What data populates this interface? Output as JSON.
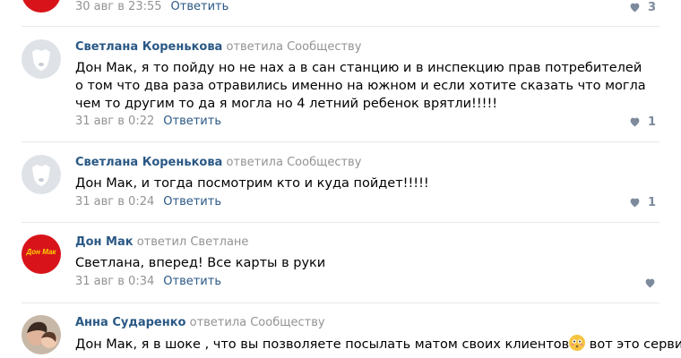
{
  "feed": {
    "prev_comment": {
      "time": "30 авг в 23:55",
      "reply_label": "Ответить",
      "likes": "3"
    },
    "comments": [
      {
        "author": "Светлана Коренькова",
        "replied_to": "ответила Сообществу",
        "text": "Дон Мак, я то пойду но не нах а в сан станцию и в инспекцию прав потребителей о том что два раза отравились именно на южном и если хотите сказать что могла чем то другим то да я могла но 4 летний ребенок врятли!!!!!",
        "time": "31 авг в 0:22",
        "reply_label": "Ответить",
        "likes": "1"
      },
      {
        "author": "Светлана Коренькова",
        "replied_to": "ответила Сообществу",
        "text": "Дон Мак, и тогда посмотрим кто и куда пойдет!!!!!",
        "time": "31 авг в 0:24",
        "reply_label": "Ответить",
        "likes": "1"
      },
      {
        "author": "Дон Мак",
        "replied_to": "ответил Светлане",
        "text": "Светлана, вперед! Все карты в руки",
        "time": "31 авг в 0:34",
        "reply_label": "Ответить",
        "likes": "",
        "avatar_logo": "Дон Мак"
      },
      {
        "author": "Анна Сударенко",
        "replied_to": "ответила Сообществу",
        "text": "Дон Мак, я в шоке , что вы позволяете посылать матом своих клиентов",
        "text_after_emoji": " вот это сервис"
      }
    ]
  },
  "colors": {
    "link": "#2a5885",
    "meta": "#939393",
    "like": "#7c8a9c",
    "brand_red": "#d8141a"
  },
  "icons": {
    "like": "heart-icon",
    "default_avatar": "dog-silhouette-avatar",
    "emoji": "flushed-face-emoji"
  }
}
